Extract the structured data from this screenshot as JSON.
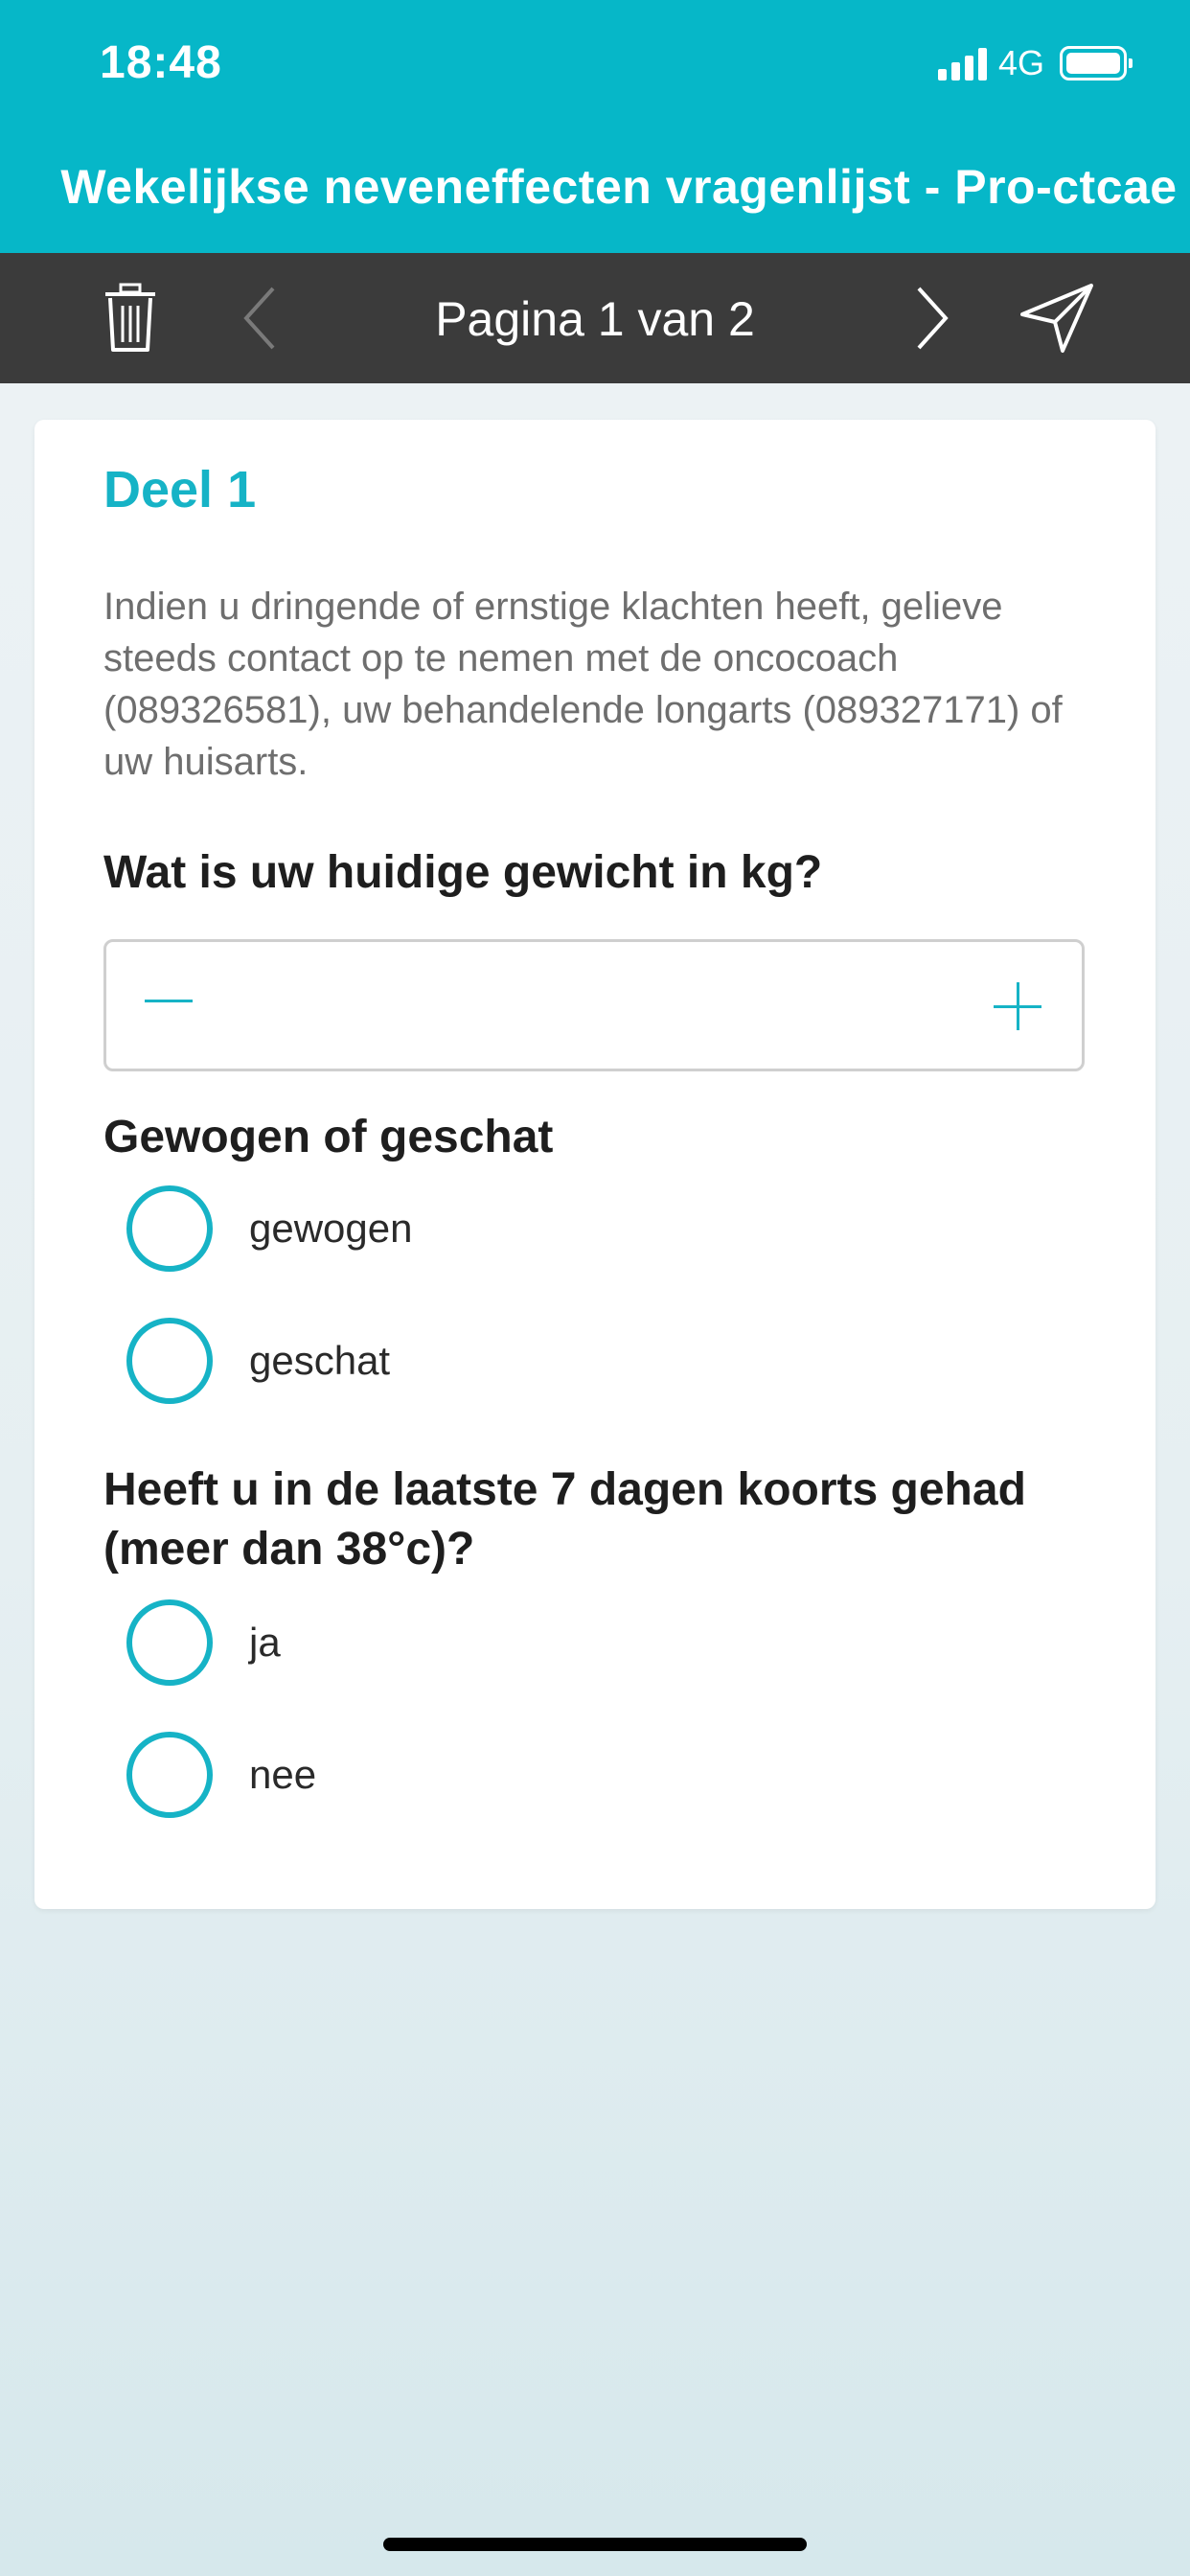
{
  "status_bar": {
    "time": "18:48",
    "network": "4G",
    "signal_bars": 4,
    "battery_level": 1.0
  },
  "header": {
    "title": "Wekelijkse neveneffecten vragenlijst - Pro-ctcae",
    "background_color": "#06b7c8"
  },
  "toolbar": {
    "page_label": "Pagina 1 van 2",
    "icons": [
      "trash-icon",
      "chevron-left-icon",
      "chevron-right-icon",
      "send-icon"
    ],
    "background_color": "#3b3b3b"
  },
  "card": {
    "section_title": "Deel 1",
    "intro": "Indien u dringende of ernstige klachten heeft, gelieve steeds contact op te nemen met de oncocoach (089326581), uw behandelende longarts (089327171) of uw huisarts.",
    "questions": [
      {
        "label": "Wat is uw huidige gewicht in kg?",
        "type": "stepper",
        "value": "",
        "placeholder": ""
      },
      {
        "label": "Gewogen of geschat",
        "type": "radio",
        "options": [
          "gewogen",
          "geschat"
        ]
      },
      {
        "label": "Heeft u in de laatste 7 dagen koorts gehad (meer dan 38°c)?",
        "type": "radio",
        "options": [
          "ja",
          "nee"
        ]
      }
    ]
  },
  "accent_color": "#16b3c6"
}
